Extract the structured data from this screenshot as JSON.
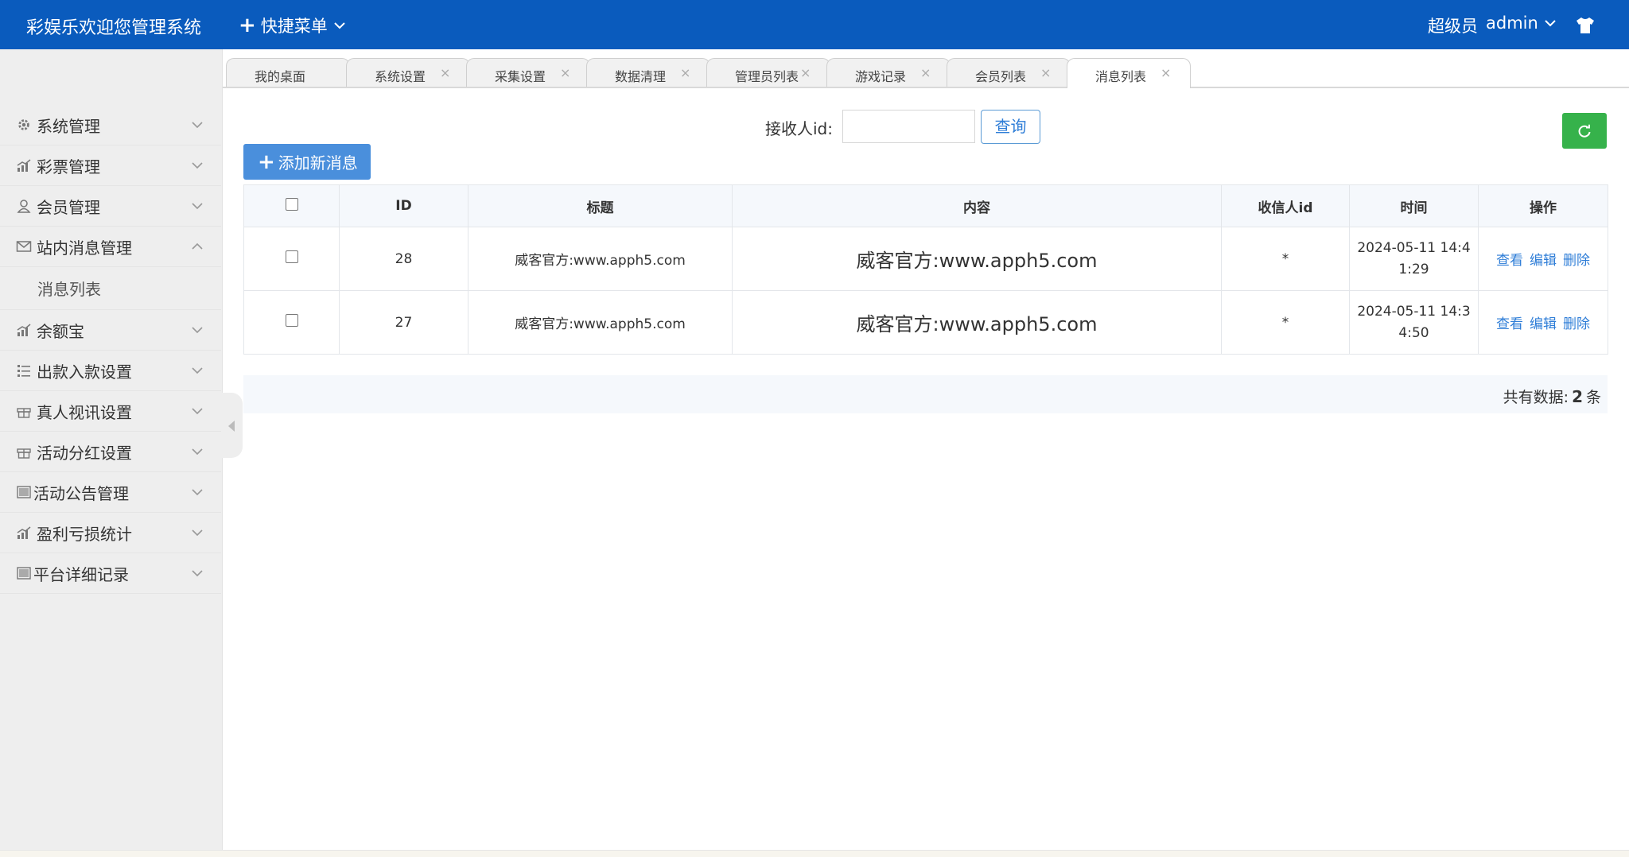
{
  "header": {
    "title": "彩娱乐欢迎您管理系统",
    "quick_menu": "快捷菜单",
    "role": "超级员",
    "username": "admin",
    "color": "#0a5bbd"
  },
  "sidebar": {
    "items": [
      {
        "label": "系统管理",
        "icon": "gear-icon"
      },
      {
        "label": "彩票管理",
        "icon": "bar-chart-icon"
      },
      {
        "label": "会员管理",
        "icon": "user-icon"
      },
      {
        "label": "站内消息管理",
        "icon": "mail-icon",
        "expanded": true
      },
      {
        "label": "余额宝",
        "icon": "bar-chart-icon"
      },
      {
        "label": "出款入款设置",
        "icon": "list-icon"
      },
      {
        "label": "真人视讯设置",
        "icon": "gift-icon"
      },
      {
        "label": "活动分红设置",
        "icon": "gift-icon"
      },
      {
        "label": "活动公告管理",
        "icon": "document-icon"
      },
      {
        "label": "盈利亏损统计",
        "icon": "bar-chart-icon"
      },
      {
        "label": "平台详细记录",
        "icon": "document-icon"
      }
    ],
    "submenu": {
      "label": "消息列表"
    }
  },
  "tabs": [
    {
      "label": "我的桌面",
      "closable": false
    },
    {
      "label": "系统设置",
      "closable": true
    },
    {
      "label": "采集设置",
      "closable": true
    },
    {
      "label": "数据清理",
      "closable": true
    },
    {
      "label": "管理员列表",
      "closable": true
    },
    {
      "label": "游戏记录",
      "closable": true
    },
    {
      "label": "会员列表",
      "closable": true
    },
    {
      "label": "消息列表",
      "closable": true,
      "active": true
    }
  ],
  "search": {
    "label": "接收人id:",
    "value": "",
    "button": "查询"
  },
  "add_button": "添加新消息",
  "table": {
    "columns": [
      "ID",
      "标题",
      "内容",
      "收信人id",
      "时间",
      "操作"
    ],
    "rows": [
      {
        "id": "28",
        "title": "威客官方:www.apph5.com",
        "content": "威客官方:www.apph5.com",
        "receiver": "*",
        "time_l1": "2024-05-11 14:4",
        "time_l2": "1:29"
      },
      {
        "id": "27",
        "title": "威客官方:www.apph5.com",
        "content": "威客官方:www.apph5.com",
        "receiver": "*",
        "time_l1": "2024-05-11 14:3",
        "time_l2": "4:50"
      }
    ],
    "actions": {
      "view": "查看",
      "edit": "编辑",
      "delete": "删除"
    }
  },
  "footer": {
    "total_label": "共有数据:",
    "total_count": "2",
    "unit": "条"
  },
  "colors": {
    "primary": "#4a8fdc",
    "refresh": "#36b24b",
    "link": "#2e7dd7"
  }
}
